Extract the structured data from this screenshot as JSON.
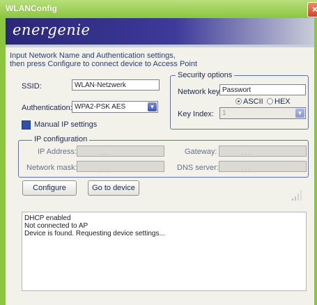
{
  "window": {
    "title": "WLANConfig",
    "close_label": "×"
  },
  "banner": {
    "logo_prefix": "ener",
    "logo_suffix": "genie"
  },
  "info": {
    "line1": "Input Network Name and Authentication settings,",
    "line2": "then press Configure to connect device to Access Point"
  },
  "form": {
    "ssid_label": "SSID:",
    "ssid_value": "WLAN-Netzwerk",
    "auth_label": "Authentication:",
    "auth_value": "WPA2-PSK AES",
    "manual_ip_label": "Manual IP settings"
  },
  "security": {
    "title": "Security options",
    "network_key_label": "Network key:",
    "network_key_value": "Passwort",
    "ascii_label": "ASCII",
    "hex_label": "HEX",
    "selected_format": "ASCII",
    "key_index_label": "Key Index:",
    "key_index_value": "1"
  },
  "ip_config": {
    "title": "IP configuration",
    "ip_address_label": "IP Address:",
    "network_mask_label": "Network mask:",
    "gateway_label": "Gateway:",
    "dns_server_label": "DNS server:",
    "ip_placeholder": ". . ."
  },
  "buttons": {
    "configure": "Configure",
    "go_to_device": "Go to device"
  },
  "log": {
    "lines": [
      "DHCP enabled",
      "Not connected to AP",
      "Device is found. Requesting device settings..."
    ]
  },
  "icons": {
    "close": "close-icon",
    "dropdown": "chevron-down-icon",
    "signal": "signal-strength-icon",
    "checkbox": "checkbox-icon"
  },
  "colors": {
    "title_bar": "#8cc63f",
    "banner": "#2b2778",
    "group_border": "#5b6fc0",
    "checkbox_fill": "#2f52a8"
  }
}
